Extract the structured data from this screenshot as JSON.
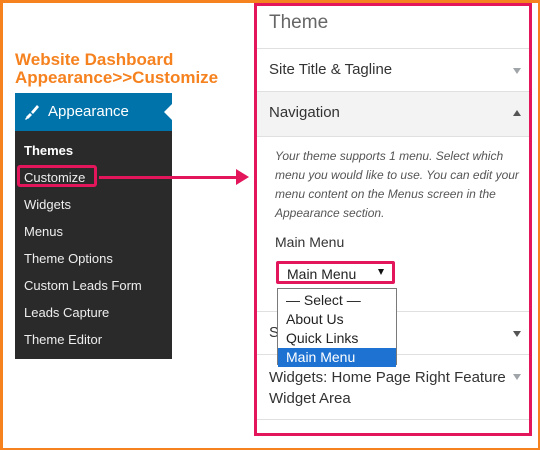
{
  "caption": {
    "line1": "Website Dashboard",
    "line2": "Appearance>>Customize"
  },
  "admin_menu": {
    "appearance_label": "Appearance",
    "items": [
      {
        "label": "Themes",
        "current": true
      },
      {
        "label": "Customize",
        "highlighted": true
      },
      {
        "label": "Widgets"
      },
      {
        "label": "Menus"
      },
      {
        "label": "Theme Options"
      },
      {
        "label": "Custom Leads Form"
      },
      {
        "label": "Leads Capture"
      },
      {
        "label": "Theme Editor"
      }
    ]
  },
  "customizer": {
    "title": "Theme",
    "sections": {
      "site_title": "Site Title & Tagline",
      "navigation": "Navigation",
      "hidden_section_initial": "S",
      "widgets": "Widgets: Home Page Right Feature Widget Area"
    },
    "navigation": {
      "description": "Your theme supports 1 menu. Select which menu you would like to use. You can edit your menu content on the Menus screen in the Appearance section.",
      "menu_label": "Main Menu",
      "selected_value": "Main Menu",
      "options": [
        "— Select —",
        "About Us",
        "Quick Links",
        "Main Menu"
      ],
      "selected_index": 3
    }
  },
  "colors": {
    "frame": "#f5821f",
    "highlight": "#e3165b",
    "menu_bg": "#2a2a2a",
    "menu_active": "#0073aa",
    "option_selected": "#1e73d2"
  }
}
